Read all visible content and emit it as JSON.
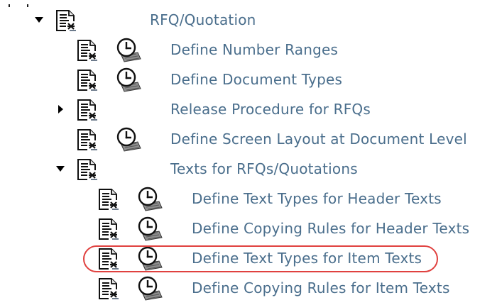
{
  "tree": {
    "items": [
      {
        "label": "RFQ/Quotation",
        "level": 0,
        "expander": "expanded",
        "has_execute": false
      },
      {
        "label": "Define Number Ranges",
        "level": 1,
        "expander": "none",
        "has_execute": true
      },
      {
        "label": "Define Document Types",
        "level": 1,
        "expander": "none",
        "has_execute": true
      },
      {
        "label": "Release Procedure for RFQs",
        "level": 1,
        "expander": "collapsed",
        "has_execute": false
      },
      {
        "label": "Define Screen Layout at Document Level",
        "level": 1,
        "expander": "none",
        "has_execute": true
      },
      {
        "label": "Texts for RFQs/Quotations",
        "level": 1,
        "expander": "expanded",
        "has_execute": false
      },
      {
        "label": "Define Text Types for Header Texts",
        "level": 2,
        "expander": "none",
        "has_execute": true
      },
      {
        "label": "Define Copying Rules for Header Texts",
        "level": 2,
        "expander": "none",
        "has_execute": true
      },
      {
        "label": "Define Text Types for Item Texts",
        "level": 2,
        "expander": "none",
        "has_execute": true,
        "highlighted": true
      },
      {
        "label": "Define Copying Rules for Item Texts",
        "level": 2,
        "expander": "none",
        "has_execute": true
      }
    ]
  },
  "icons": {
    "document": "documentation-icon",
    "execute": "execute-clock-icon",
    "expanded": "expanded-triangle-icon",
    "collapsed": "collapsed-triangle-icon"
  },
  "colors": {
    "label": "#4a6e8c",
    "highlight": "#e0413f"
  }
}
